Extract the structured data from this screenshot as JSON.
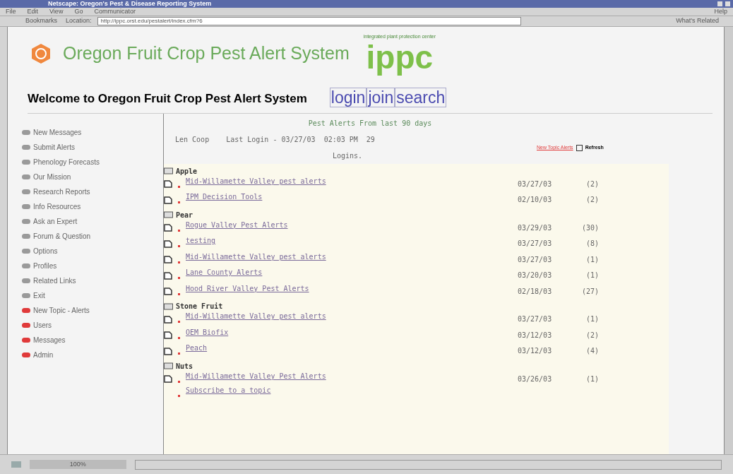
{
  "window": {
    "title": "Netscape: Oregon's Pest & Disease Reporting System"
  },
  "menu": {
    "left": [
      "File",
      "Edit",
      "View",
      "Go",
      "Communicator"
    ],
    "right": "Help"
  },
  "toolbar": {
    "bookmarks": "Bookmarks",
    "location_label": "Location:",
    "url": "http://ippc.orst.edu/pestalert/index.cfm?6",
    "related": "What's Related"
  },
  "header": {
    "title": "Oregon Fruit Crop Pest Alert System",
    "logo_caption": "integrated plant protection center",
    "logo_text": "ippc"
  },
  "welcome": "Welcome to Oregon Fruit Crop Pest Alert System",
  "top_links": [
    "login",
    "join",
    "search"
  ],
  "sidebar": {
    "items": [
      {
        "label": "New Messages",
        "color": "#9a9a9a"
      },
      {
        "label": "Submit Alerts",
        "color": "#9a9a9a"
      },
      {
        "label": "Phenology Forecasts",
        "color": "#9a9a9a"
      },
      {
        "label": "Our Mission",
        "color": "#9a9a9a"
      },
      {
        "label": "Research Reports",
        "color": "#9a9a9a"
      },
      {
        "label": "Info Resources",
        "color": "#9a9a9a"
      },
      {
        "label": "Ask an Expert",
        "color": "#9a9a9a"
      },
      {
        "label": "Forum & Question",
        "color": "#9a9a9a"
      },
      {
        "label": "Options",
        "color": "#9a9a9a"
      },
      {
        "label": "Profiles",
        "color": "#9a9a9a"
      },
      {
        "label": "Related Links",
        "color": "#9a9a9a"
      },
      {
        "label": "Exit",
        "color": "#9a9a9a"
      },
      {
        "label": "New Topic - Alerts",
        "color": "#e03a3a"
      },
      {
        "label": "Users",
        "color": "#e03a3a"
      },
      {
        "label": "Messages",
        "color": "#e03a3a"
      },
      {
        "label": "Admin",
        "color": "#e03a3a"
      }
    ]
  },
  "alerts": {
    "heading": "Pest Alerts From last 90 days",
    "user": "Len Coop",
    "last_login": "Last Login - 03/27/03  02:03 PM  29",
    "logins": "Logins.",
    "new_topic_alerts": "New Topic Alerts",
    "refresh": "Refresh",
    "groups": [
      {
        "name": "Apple",
        "items": [
          {
            "title": "Mid-Willamette Valley pest alerts",
            "date": "03/27/03",
            "count": "(2)"
          },
          {
            "title": "IPM Decision Tools",
            "date": "02/10/03",
            "count": "(2)"
          }
        ]
      },
      {
        "name": "Pear",
        "items": [
          {
            "title": "Rogue Valley Pest Alerts",
            "date": "03/29/03",
            "count": "(30)"
          },
          {
            "title": "testing",
            "date": "03/27/03",
            "count": "(8)"
          },
          {
            "title": "Mid-Willamette Valley pest alerts",
            "date": "03/27/03",
            "count": "(1)"
          },
          {
            "title": "Lane County Alerts",
            "date": "03/20/03",
            "count": "(1)"
          },
          {
            "title": "Hood River Valley Pest Alerts",
            "date": "02/18/03",
            "count": "(27)"
          }
        ]
      },
      {
        "name": "Stone Fruit",
        "items": [
          {
            "title": "Mid-Willamette Valley pest alerts",
            "date": "03/27/03",
            "count": "(1)"
          },
          {
            "title": "OEM Biofix",
            "date": "03/12/03",
            "count": "(2)"
          },
          {
            "title": "Peach",
            "date": "03/12/03",
            "count": "(4)"
          }
        ]
      },
      {
        "name": "Nuts",
        "items": [
          {
            "title": "Mid-Willamette Valley Pest Alerts",
            "date": "03/26/03",
            "count": "(1)"
          }
        ]
      }
    ],
    "subscribe": "Subscribe to a topic"
  },
  "status_bar": {
    "zoom": "100%"
  }
}
